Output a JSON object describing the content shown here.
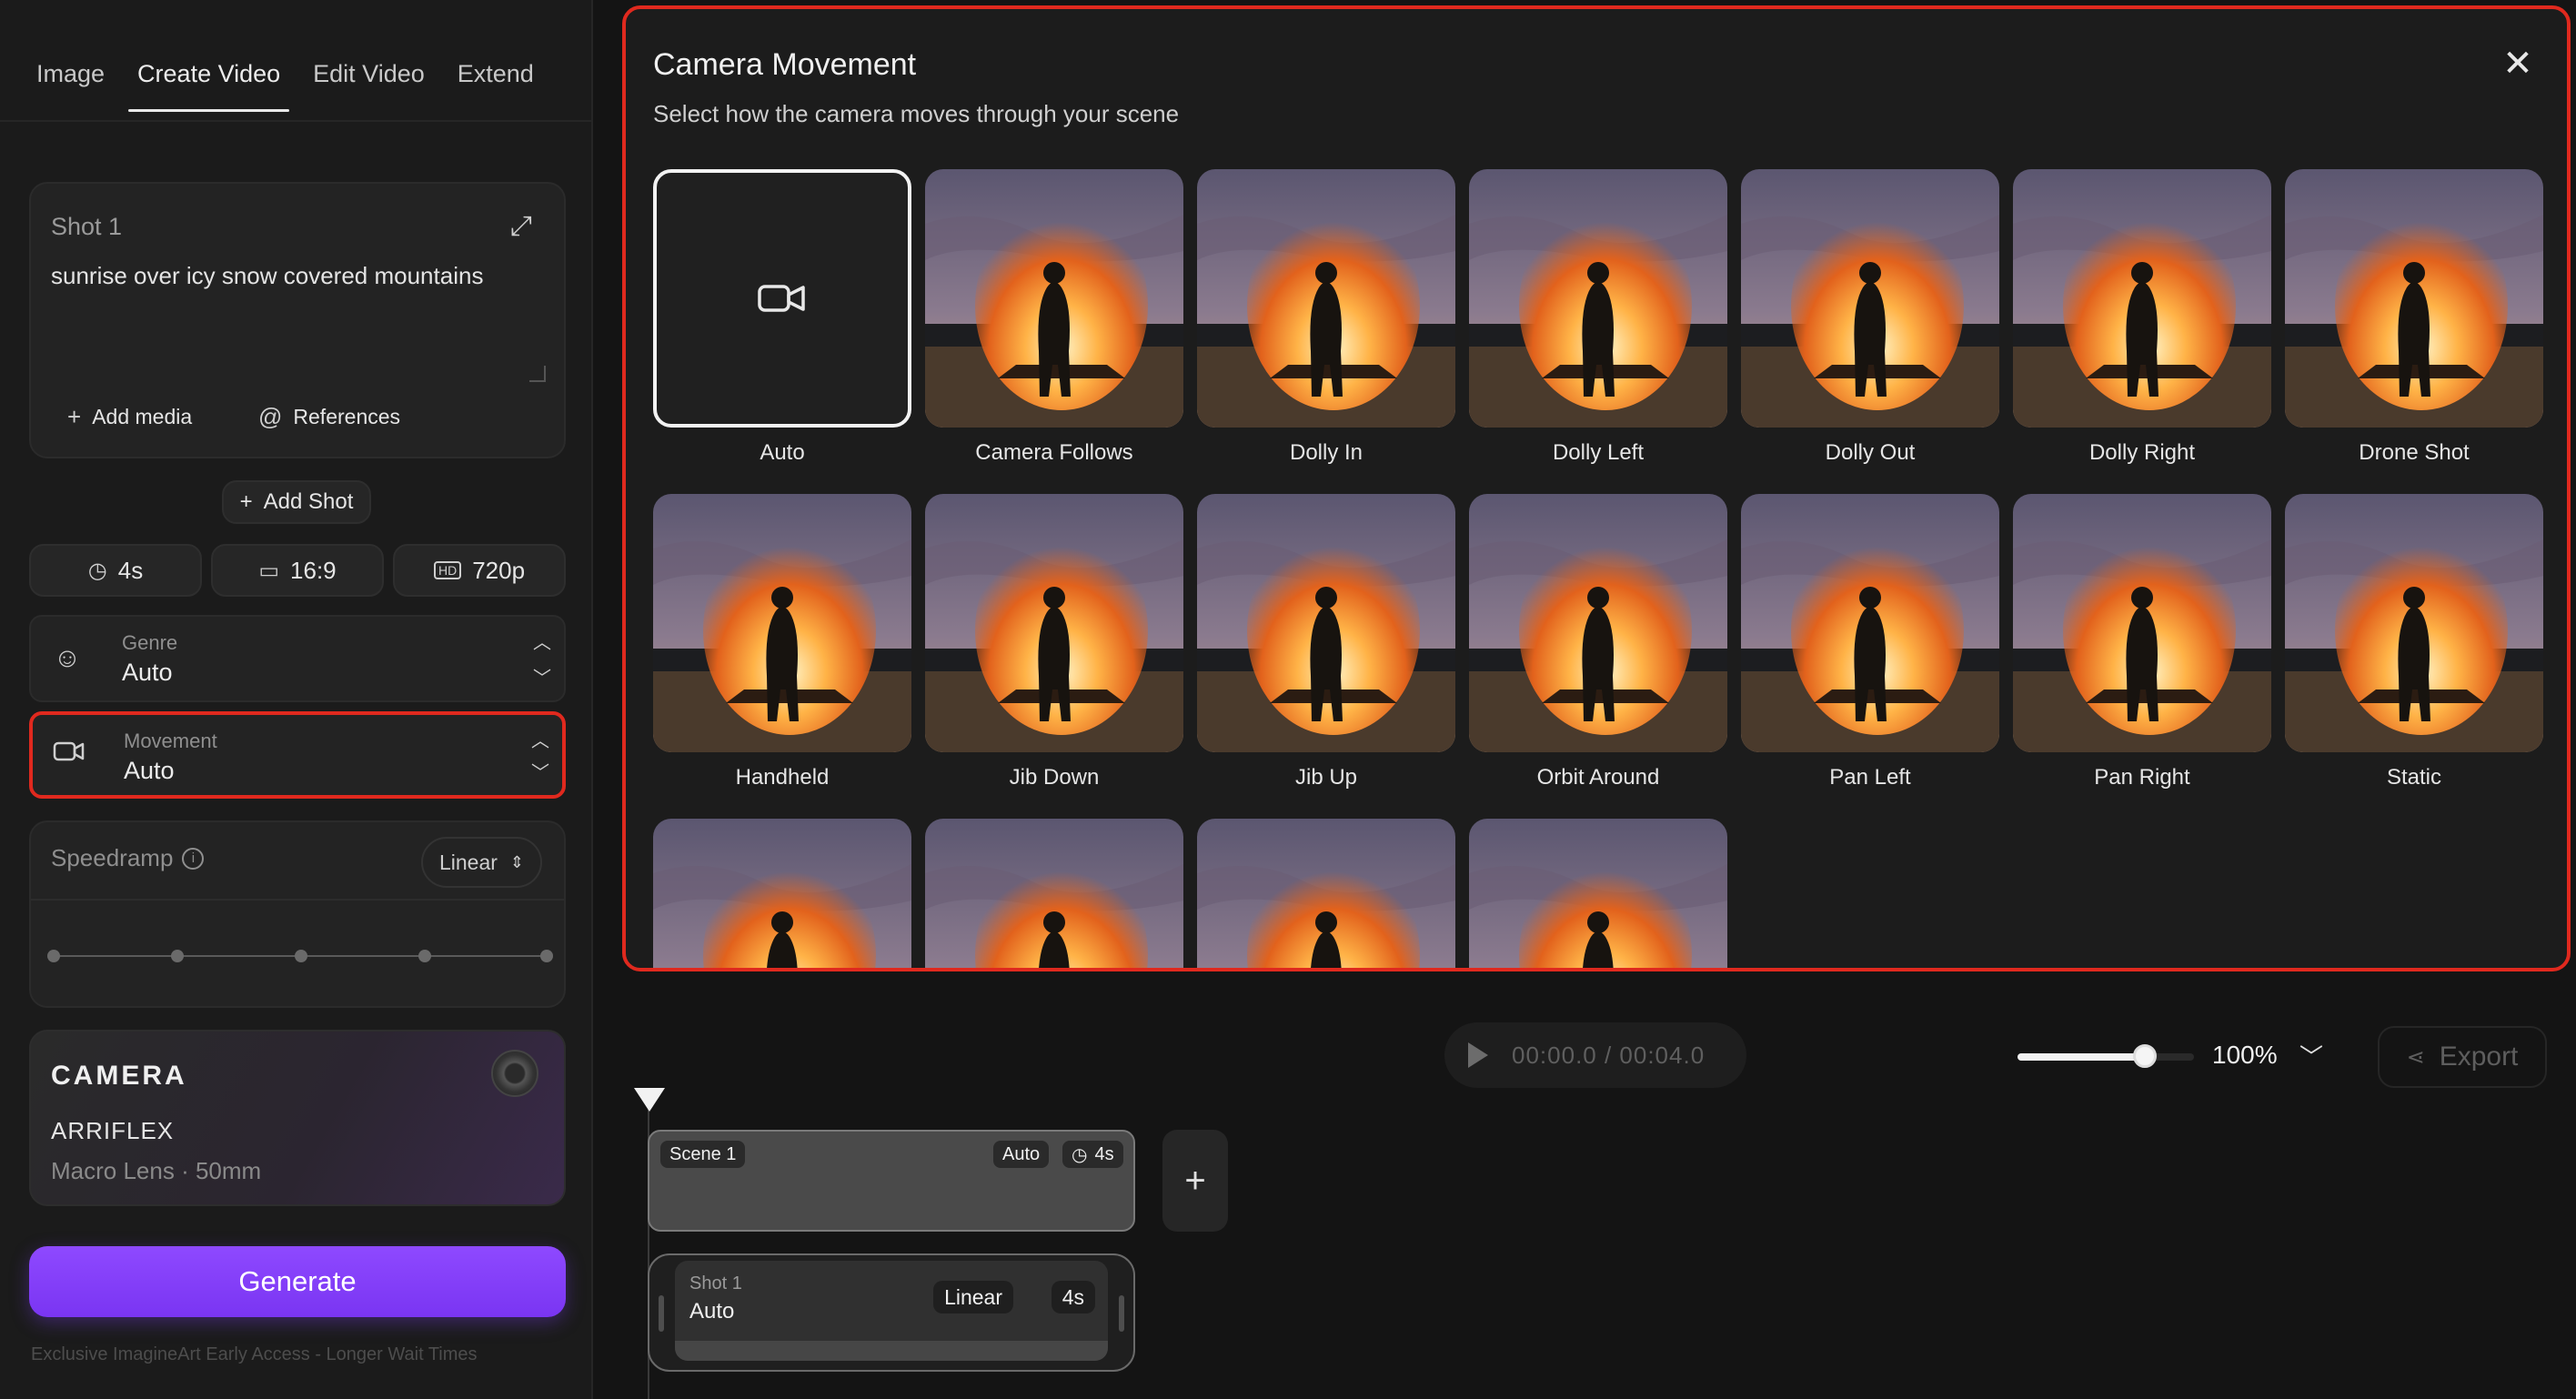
{
  "tabs": [
    {
      "label": "Image",
      "active": false
    },
    {
      "label": "Create Video",
      "active": true
    },
    {
      "label": "Edit Video",
      "active": false
    },
    {
      "label": "Extend",
      "active": false
    }
  ],
  "shot": {
    "title": "Shot 1",
    "prompt": "sunrise over icy snow covered mountains",
    "add_media_label": "Add media",
    "references_label": "References"
  },
  "add_shot_label": "Add Shot",
  "settings": {
    "duration": "4s",
    "aspect": "16:9",
    "resolution": "720p"
  },
  "genre": {
    "label": "Genre",
    "value": "Auto"
  },
  "movement": {
    "label": "Movement",
    "value": "Auto"
  },
  "speedramp": {
    "label": "Speedramp",
    "value": "Linear"
  },
  "camera": {
    "title": "CAMERA",
    "model": "ARRIFLEX",
    "lens": "Macro Lens · 50mm"
  },
  "generate_label": "Generate",
  "footer_note": "Exclusive ImagineArt Early Access - Longer Wait Times",
  "modal": {
    "title": "Camera Movement",
    "subtitle": "Select how the camera moves through your scene",
    "selected": "Auto",
    "options": [
      "Auto",
      "Camera Follows",
      "Dolly In",
      "Dolly Left",
      "Dolly Out",
      "Dolly Right",
      "Drone Shot",
      "Handheld",
      "Jib Down",
      "Jib Up",
      "Orbit Around",
      "Pan Left",
      "Pan Right",
      "Static",
      "",
      "",
      "",
      ""
    ]
  },
  "player": {
    "time": "00:00.0 / 00:04.0",
    "zoom": "100%",
    "zoom_fraction": 0.72,
    "export_label": "Export"
  },
  "timeline": {
    "scene": {
      "label": "Scene 1",
      "movement": "Auto",
      "duration": "4s"
    },
    "shot": {
      "label": "Shot 1",
      "value": "Auto",
      "speed": "Linear",
      "duration": "4s"
    }
  },
  "icons": {
    "expand": "expand-icon",
    "plus": "plus-icon",
    "at": "at-icon",
    "clock": "clock-icon",
    "aspect": "aspect-icon",
    "hd": "hd-icon",
    "genre": "masks-icon",
    "movement": "video-camera-icon",
    "info": "info-icon",
    "close": "close-icon",
    "play": "play-icon",
    "share": "share-icon"
  },
  "colors": {
    "accent": "#7a35f2",
    "highlight": "#e0291e"
  }
}
